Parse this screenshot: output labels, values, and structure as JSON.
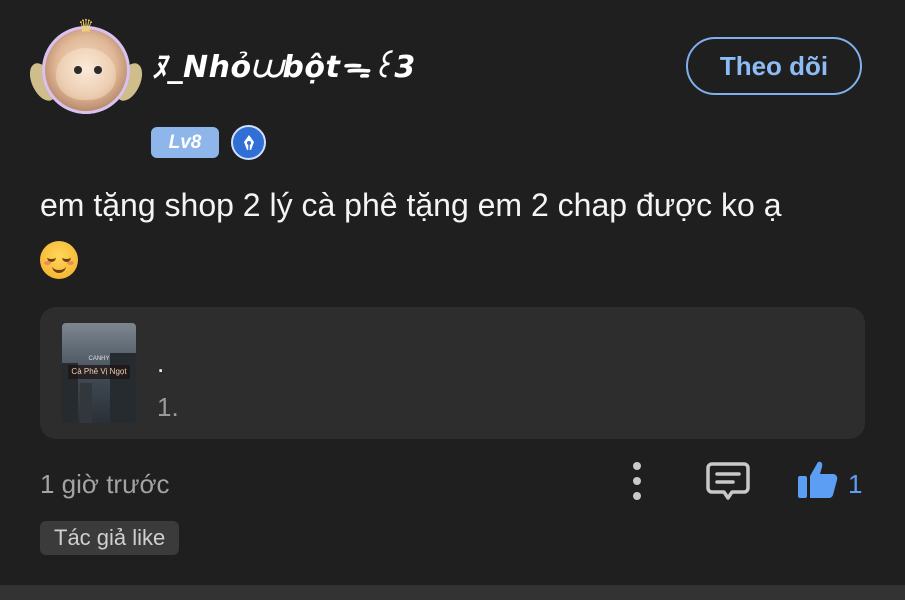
{
  "comment": {
    "username": "ﾇ_Nhỏ⩊bột⁠ᯓ꒰3",
    "level_badge": "Lv8",
    "follow_label": "Theo dõi",
    "text": "em tặng shop 2 lý cà phê tặng em 2 chap được ko ạ",
    "emoji": "smiling-face-emoji",
    "time": "1 giờ trước",
    "like_count": "1",
    "author_like_label": "Tác giả like"
  },
  "book": {
    "cover_tag": "CANHY",
    "cover_title": "Cà Phê Vị Ngọt",
    "title": ".",
    "chapter": "1."
  },
  "colors": {
    "background": "#1f1f1f",
    "accent_blue": "#8dbcf5",
    "like_blue": "#5b9ef4",
    "card": "#2d2d2d"
  },
  "icons": {
    "more": "more-vertical-icon",
    "reply": "comment-reply-icon",
    "like": "thumbs-up-icon",
    "badge": "pen-nib-icon"
  }
}
